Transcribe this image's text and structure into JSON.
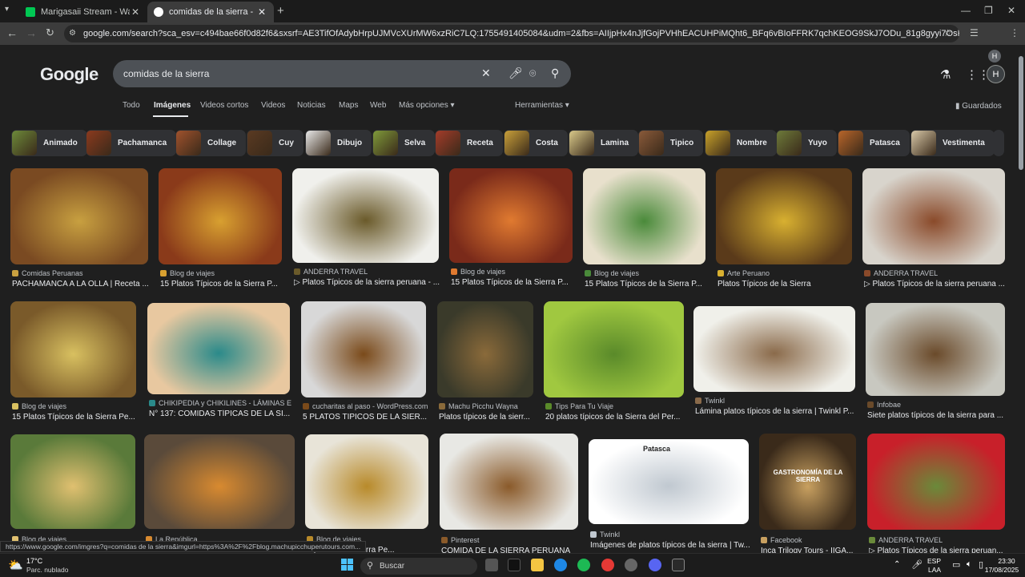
{
  "browser": {
    "tabs": [
      {
        "label": "Marigasaii Stream - Watch Live",
        "close": "✕"
      },
      {
        "label": "comidas de la sierra - Buscar con Google",
        "close": "✕"
      }
    ],
    "new_tab": "+",
    "url": "google.com/search?sca_esv=c494bae66f0d82f6&sxsrf=AE3TifOfAdybHrpUJMVcXUrMW6xzRiC7LQ:1755491405084&udm=2&fbs=AIIjpHx4nJjfGojPVHhEACUHPiMQht6_BFq6vBIoFFRK7qchKEOG9SkJ7ODu_81g8gyyi7OsPNjpDI3V0JjLtQKJuuQU87wZYrBPArnM...",
    "profile": "H"
  },
  "google": {
    "logo": "Google",
    "query": "comidas de la sierra",
    "avatar": "H",
    "nav_tabs": [
      "Todo",
      "Imágenes",
      "Videos cortos",
      "Videos",
      "Noticias",
      "Maps",
      "Web",
      "Más opciones ▾"
    ],
    "tools": "Herramientas ▾",
    "saved": "Guardados"
  },
  "chips": [
    "Animado",
    "Pachamanca",
    "Collage",
    "Cuy",
    "Dibujo",
    "Selva",
    "Receta",
    "Costa",
    "Lamina",
    "Tipico",
    "Nombre",
    "Yuyo",
    "Patasca",
    "Vestimenta"
  ],
  "results": [
    {
      "source": "Comidas Peruanas",
      "title": "PACHAMANCA A LA OLLA | Receta ..."
    },
    {
      "source": "Blog de viajes",
      "title": "15 Platos Típicos de la Sierra P..."
    },
    {
      "source": "ANDERRA TRAVEL",
      "title": "▷ Platos Típicos de la sierra peruana - ..."
    },
    {
      "source": "Blog de viajes",
      "title": "15 Platos Típicos de la Sierra P..."
    },
    {
      "source": "Blog de viajes",
      "title": "15 Platos Típicos de la Sierra P..."
    },
    {
      "source": "Arte Peruano",
      "title": "Platos Típicos de la Sierra"
    },
    {
      "source": "ANDERRA TRAVEL",
      "title": "▷ Platos Típicos de la sierra peruana ..."
    },
    {
      "source": "Blog de viajes",
      "title": "15 Platos Típicos de la Sierra Pe..."
    },
    {
      "source": "CHIKIPEDIA y CHIKILINES - LÁMINAS E...",
      "title": "N° 137: COMIDAS TÍPICAS DE LA SI..."
    },
    {
      "source": "cucharitas al paso - WordPress.com",
      "title": "5 PLATOS TIPICOS DE LA SIER..."
    },
    {
      "source": "Machu Picchu Wayna",
      "title": "Platos típicos de la sierr..."
    },
    {
      "source": "Tips Para Tu Viaje",
      "title": "20 platos típicos de la Sierra del Per..."
    },
    {
      "source": "Twinkl",
      "title": "Lámina platos típicos de la sierra | Twinkl P..."
    },
    {
      "source": "Infobae",
      "title": "Siete platos típicos de la sierra para ..."
    },
    {
      "source": "Blog de viajes",
      "title": ""
    },
    {
      "source": "La República",
      "title": ""
    },
    {
      "source": "Blog de viajes",
      "title": "Típicos de la Sierra Pe..."
    },
    {
      "source": "Pinterest",
      "title": "COMIDA DE LA SIERRA PERUANA"
    },
    {
      "source": "Twinkl",
      "title": "Imágenes de platos típicos de la sierra | Tw..."
    },
    {
      "source": "Facebook",
      "title": "Inca Trilogy Tours - IIGA..."
    },
    {
      "source": "ANDERRA TRAVEL",
      "title": "▷ Platos Típicos de la sierra peruan..."
    }
  ],
  "image_overlay_labels": {
    "patasca": "Patasca",
    "gastronomia": "GASTRONOMÍA DE LA SIERRA"
  },
  "status_url": "https://www.google.com/imgres?q=comidas de la sierra&imgurl=https%3A%2F%2Fblog.machupicchuperutours.com...",
  "taskbar": {
    "temp": "17°C",
    "weather": "Parc. nublado",
    "search": "Buscar",
    "lang1": "ESP",
    "lang2": "LAA",
    "time": "23:30",
    "date": "17/08/2025"
  }
}
